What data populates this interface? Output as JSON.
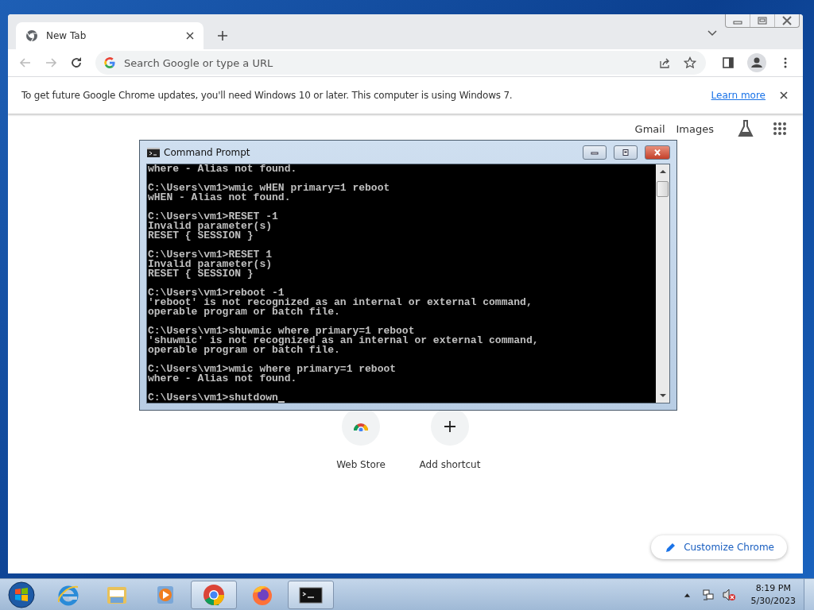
{
  "browser": {
    "tabs": [
      {
        "title": "New Tab",
        "selected": true
      }
    ],
    "address_bar": {
      "placeholder": "Search Google or type a URL"
    },
    "infobar": {
      "message": "To get future Google Chrome updates, you'll need Windows 10 or later. This computer is using Windows 7.",
      "link": "Learn more"
    },
    "header_links": [
      "Gmail",
      "Images"
    ],
    "shortcuts": [
      {
        "kind": "webstore",
        "label": "Web Store"
      },
      {
        "kind": "add",
        "label": "Add shortcut"
      }
    ],
    "customize_button": "Customize Chrome"
  },
  "console": {
    "title": "Command Prompt",
    "blocks": [
      [
        "where - Alias not found."
      ],
      [
        "C:\\Users\\vm1>wmic wHEN primary=1 reboot",
        "wHEN - Alias not found."
      ],
      [
        "C:\\Users\\vm1>RESET -1",
        "Invalid parameter(s)",
        "RESET { SESSION }"
      ],
      [
        "C:\\Users\\vm1>RESET 1",
        "Invalid parameter(s)",
        "RESET { SESSION }"
      ],
      [
        "C:\\Users\\vm1>reboot -1",
        "'reboot' is not recognized as an internal or external command,",
        "operable program or batch file."
      ],
      [
        "C:\\Users\\vm1>shuwmic where primary=1 reboot",
        "'shuwmic' is not recognized as an internal or external command,",
        "operable program or batch file."
      ],
      [
        "C:\\Users\\vm1>wmic where primary=1 reboot",
        "where - Alias not found."
      ]
    ],
    "prompt": "C:\\Users\\vm1>shutdown"
  },
  "taskbar": {
    "apps": [
      {
        "kind": "ie",
        "active": false
      },
      {
        "kind": "explorer",
        "active": false
      },
      {
        "kind": "media",
        "active": false
      },
      {
        "kind": "chrome",
        "active": true
      },
      {
        "kind": "firefox",
        "active": false
      },
      {
        "kind": "cmd",
        "active": true
      }
    ],
    "clock": {
      "time": "8:19 PM",
      "date": "5/30/2023"
    }
  }
}
